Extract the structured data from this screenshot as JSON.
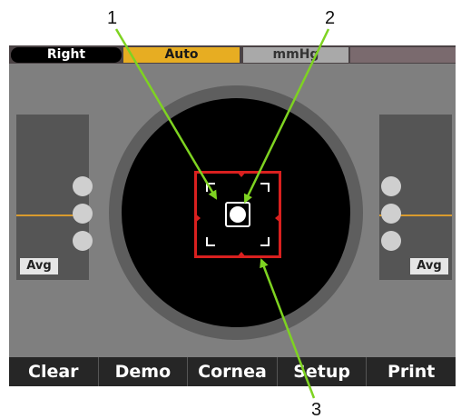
{
  "callouts": {
    "c1": "1",
    "c2": "2",
    "c3": "3"
  },
  "status_bar": {
    "eye": "Right",
    "mode": "Auto",
    "unit": "mmHg"
  },
  "left_panel": {
    "avg_label": "Avg"
  },
  "right_panel": {
    "avg_label": "Avg"
  },
  "softkeys": [
    "Clear",
    "Demo",
    "Cornea",
    "Setup",
    "Print"
  ],
  "colors": {
    "screen_bg": "#7f7f7f",
    "auto_tag": "#e7ad22",
    "target_frame": "#d9201f",
    "callout_arrow": "#7ed321",
    "level_line": "#d99b2e"
  }
}
